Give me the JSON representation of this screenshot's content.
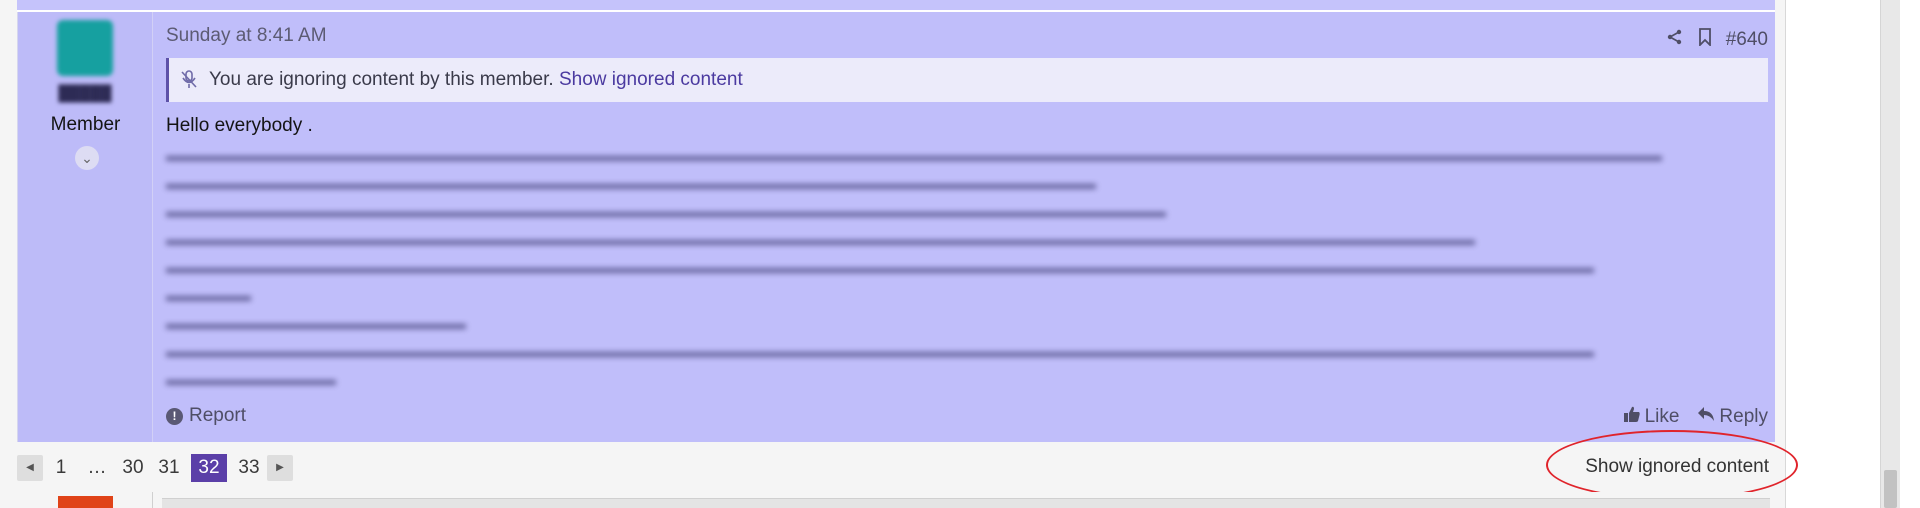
{
  "post": {
    "date": "Sunday at 8:41 AM",
    "post_number": "#640",
    "user": {
      "role": "Member"
    },
    "ignored_notice": {
      "text": "You are ignoring content by this member.",
      "link": "Show ignored content"
    },
    "greeting": "Hello everybody .",
    "report_label": "Report",
    "like_label": "Like",
    "reply_label": "Reply"
  },
  "pagination": {
    "pages": [
      "1",
      "…",
      "30",
      "31",
      "32",
      "33"
    ],
    "current": "32"
  },
  "show_ignored_label": "Show ignored content",
  "icons": {
    "share": "share-icon",
    "bookmark": "bookmark-icon",
    "mute": "mute-icon",
    "info": "info-icon",
    "like": "thumbs-up-icon",
    "reply": "reply-icon",
    "prev": "caret-left-icon",
    "next": "caret-right-icon",
    "expand": "chevron-down-icon"
  },
  "colors": {
    "post_bg": "#c0befa",
    "accent": "#5b3fa8",
    "highlight_circle": "#e0242b"
  }
}
